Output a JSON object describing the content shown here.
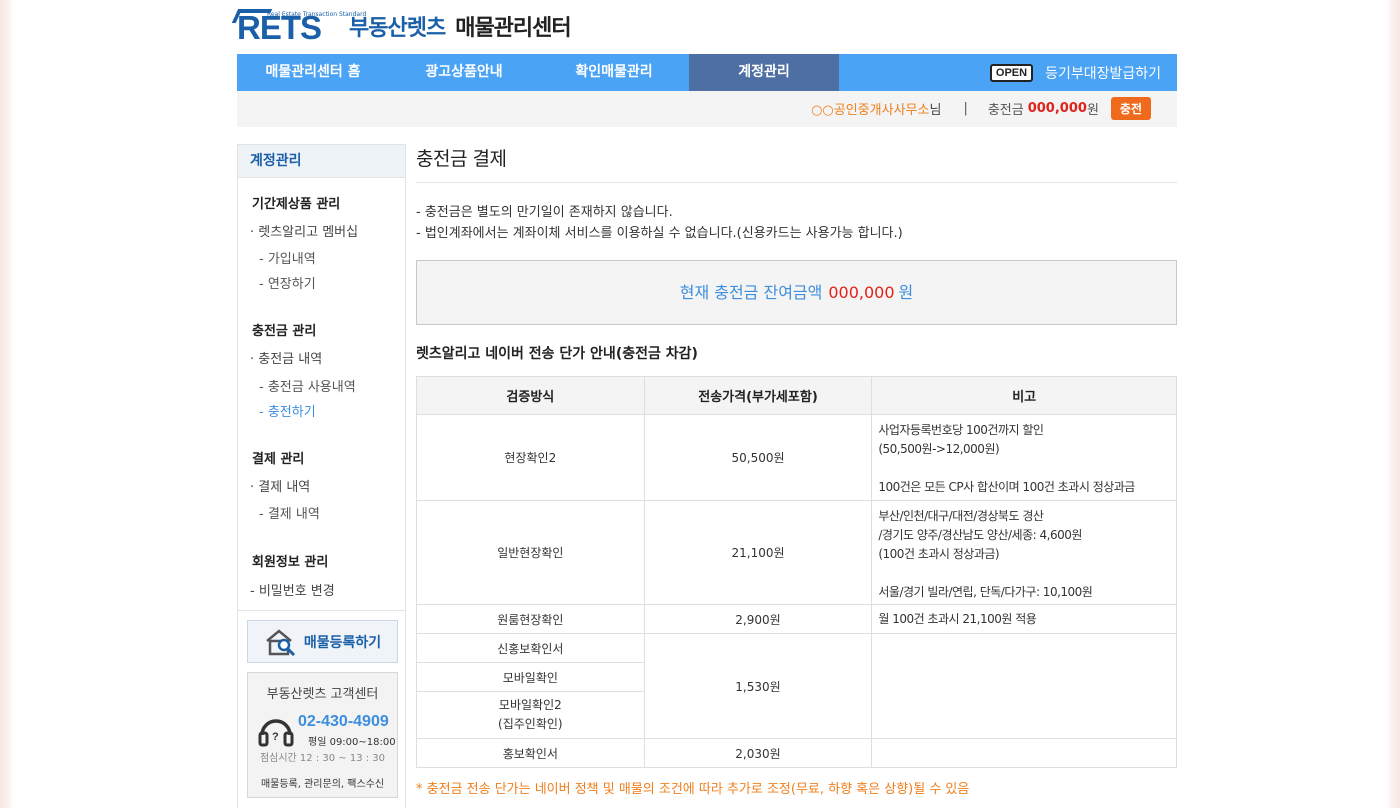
{
  "header": {
    "logo_en": "RETS",
    "logo_tagline": "Real Estate Transaction Standard",
    "logo_ko": "부동산렛츠",
    "center_title": "매물관리센터"
  },
  "nav": {
    "items": [
      {
        "label": "매물관리센터 홈"
      },
      {
        "label": "광고상품안내"
      },
      {
        "label": "확인매물관리"
      },
      {
        "label": "계정관리"
      }
    ],
    "open_badge": "OPEN",
    "open_label": "등기부대장발급하기"
  },
  "userbar": {
    "office": "○○공인중개사사무소",
    "suffix": "님",
    "separator": "|",
    "balance_label": "충전금",
    "balance_value": "000,000",
    "unit": "원",
    "charge_button": "충전"
  },
  "sidebar": {
    "title": "계정관리",
    "group1": "기간제상품 관리",
    "g1_item": "· 렛츠알리고 멤버십",
    "g1_sub1": "- 가입내역",
    "g1_sub2": "- 연장하기",
    "group2": "충전금 관리",
    "g2_item": "· 충전금 내역",
    "g2_sub1": "- 충전금 사용내역",
    "g2_sub2": "- 충전하기",
    "group3": "결제 관리",
    "g3_item": "· 결제 내역",
    "g3_sub1": "- 결제 내역",
    "group4": "회원정보 관리",
    "g4_item": "- 비밀번호 변경",
    "register_button": "매물등록하기",
    "cs": {
      "title": "부동산렛츠 고객센터",
      "phone": "02-430-4909",
      "weekday": "평일  09:00~18:00",
      "lunch": "점심시간  12 : 30 ~ 13 : 30",
      "footer": "매물등록, 관리문의, 팩스수신"
    }
  },
  "main": {
    "title": "충전금 결제",
    "notice1": "- 충전금은 별도의 만기일이 존재하지 않습니다.",
    "notice2": "- 법인계좌에서는 계좌이체 서비스를 이용하실 수 없습니다.(신용카드는 사용가능 합니다.)",
    "balance_label": "현재 충전금 잔여금액",
    "balance_value": "000,000",
    "balance_unit": "원",
    "price_title": "렛츠알리고 네이버 전송 단가 안내(충전금 차감)",
    "table": {
      "headers": [
        "검증방식",
        "전송가격(부가세포함)",
        "비고"
      ],
      "r1_method": "현장확인2",
      "r1_price": "50,500원",
      "r1_note1": "사업자등록번호당 100건까지 할인",
      "r1_note2": "(50,500원->12,000원)",
      "r1_note3": "100건은 모든 CP사 합산이며 100건 초과시 정상과금",
      "r2_method": "일반현장확인",
      "r2_price": "21,100원",
      "r2_note1": "부산/인천/대구/대전/경상북도 경산",
      "r2_note2": "/경기도 양주/경산남도 양산/세종: 4,600원",
      "r2_note3": "(100건 초과시 정상과금)",
      "r2_note4": "서울/경기 빌라/연립, 단독/다가구: 10,100원",
      "r3_method": "원룸현장확인",
      "r3_price": "2,900원",
      "r3_note": "월 100건 초과시 21,100원 적용",
      "r4_method": "신홍보확인서",
      "r5_method": "모바일확인",
      "r6_method_l1": "모바일확인2",
      "r6_method_l2": "(집주인확인)",
      "r456_price": "1,530원",
      "r7_method": "홍보확인서",
      "r7_price": "2,030원"
    },
    "footnote": "* 충전금 전송 단가는 네이버 정책 및 매물의 조건에 따라 추가로 조정(무료, 하향 혹은 상향)될 수 있음"
  },
  "colors": {
    "nav_bg": "#4aa3f4",
    "nav_active": "#4d6fa3",
    "brand_blue": "#1a5fa8",
    "accent_orange": "#f06a1d",
    "value_red": "#e0231b"
  }
}
